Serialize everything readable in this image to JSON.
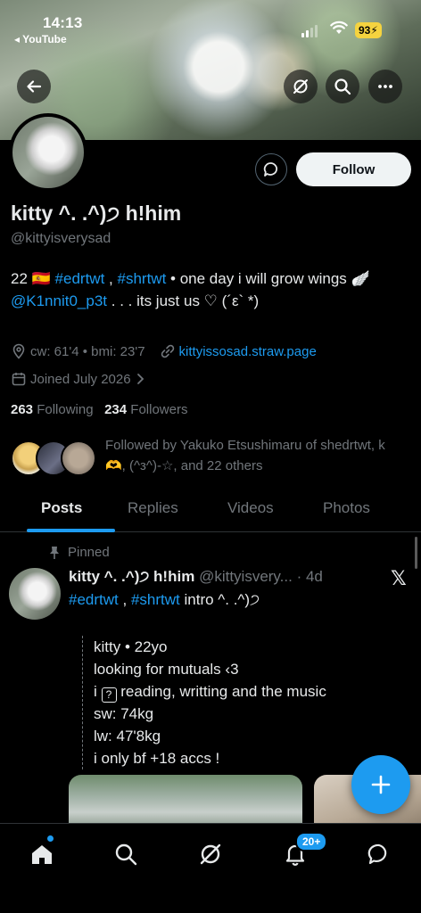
{
  "status_bar": {
    "time": "14:13",
    "back_app": "◂ YouTube",
    "battery": "93"
  },
  "profile": {
    "display_name": "kitty ^. .^)੭ h!him",
    "handle": "@kittyisverysad",
    "bio_line1_prefix": "22 🇪🇸",
    "bio_tag1": "#edrtwt",
    "bio_sep": ",",
    "bio_tag2": "#shrtwt",
    "bio_line1_suffix": "• one day i will grow wings 🪽",
    "bio_mention": "@K1nnit0_p3t",
    "bio_line2_suffix": ". . . its just us ♡ (´ε` *)",
    "location": "cw: 61'4 • bmi: 23'7",
    "website": "kittyissosad.straw.page",
    "joined": "Joined July 2026",
    "following_count": "263",
    "following_label": "Following",
    "followers_count": "234",
    "followers_label": "Followers",
    "followed_by": "Followed by Yakuko Etsushimaru of shedrtwt, k 🫶, (^з^)-☆, and 22 others",
    "follow_label": "Follow"
  },
  "tabs": [
    "Posts",
    "Replies",
    "Videos",
    "Photos"
  ],
  "post": {
    "pinned_label": "Pinned",
    "name": "kitty ^. .^)੭ h!him",
    "meta": "@kittyisvery... · 4d",
    "tag1": "#edrtwt",
    "sep": ",",
    "tag2": "#shrtwt",
    "line1_suffix": "intro ^. .^)੭",
    "lines": [
      "kitty • 22yo",
      "looking for mutuals ‹3",
      "reading, writting and the music",
      "sw: 74kg",
      "lw: 47'8kg",
      "i only bf +18 accs !"
    ],
    "line3_prefix": "i",
    "unknown_glyph": "?",
    "x_logo": "𝕏"
  },
  "nav": {
    "notifications_badge": "20+"
  },
  "colors": {
    "accent": "#1d9bf0",
    "muted": "#71767b",
    "text": "#e7e9ea",
    "background": "#000000"
  },
  "icons": [
    "back-arrow-icon",
    "grok-icon",
    "search-icon",
    "more-icon",
    "message-icon",
    "location-icon",
    "link-icon",
    "calendar-icon",
    "pin-icon",
    "x-logo-icon",
    "plus-icon",
    "home-icon",
    "explore-icon",
    "grok-nav-icon",
    "bell-icon",
    "chat-icon"
  ]
}
